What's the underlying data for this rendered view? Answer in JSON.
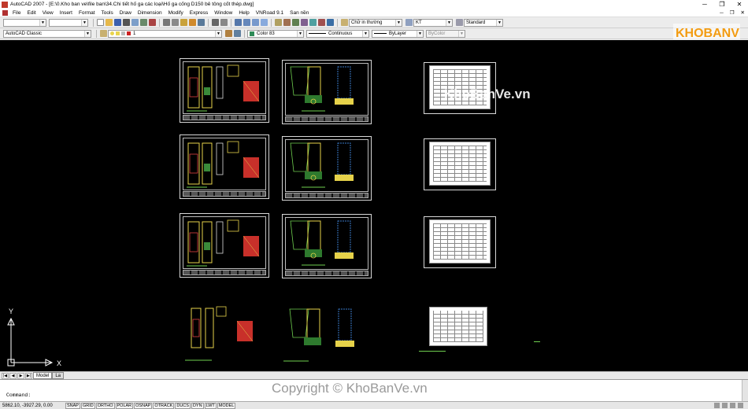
{
  "window": {
    "title": "AutoCAD 2007 - [E:\\0.Kho ban ve\\file ban\\34.Chi tiết hố ga các loại\\Hố ga cống D150 bê tông cốt thép.dwg]",
    "minimize": "─",
    "restore": "❐",
    "close": "✕"
  },
  "menu": {
    "items": [
      "File",
      "Edit",
      "View",
      "Insert",
      "Format",
      "Tools",
      "Draw",
      "Dimension",
      "Modify",
      "Express",
      "Window",
      "Help",
      "VNRoad 9.1",
      "San nền"
    ],
    "close_doc": "✕",
    "restore_doc": "❐",
    "minimize_doc": "─"
  },
  "toolbar1": {
    "textstyle": "Chữ in thường",
    "dimstyle": "KT",
    "tablestyle": "Standard"
  },
  "toolbar2": {
    "workspace": "AutoCAD Classic",
    "layer": "1",
    "color": "Color 83",
    "linetype": "Continuous",
    "lineweight": "ByLayer",
    "plotstyle": "ByColor"
  },
  "colors": {
    "canvas": "#000000",
    "layer_swatch": "#cc2222",
    "color_swatch": "#2e8b57",
    "logo_orange": "#f39c12"
  },
  "ucs": {
    "x": "X",
    "y": "Y"
  },
  "tabs": {
    "model": "Model",
    "layout": "La"
  },
  "command": {
    "prompt": "Command:"
  },
  "status": {
    "coords": "5862.10, -3927.29, 0.00",
    "buttons": [
      "SNAP",
      "GRID",
      "ORTHO",
      "POLAR",
      "OSNAP",
      "OTRACK",
      "DUCS",
      "DYN",
      "LWT",
      "MODEL"
    ]
  },
  "watermarks": {
    "top": "KhoBanVe.vn",
    "bottom": "Copyright © KhoBanVe.vn",
    "logo": "KHOBANVE"
  }
}
